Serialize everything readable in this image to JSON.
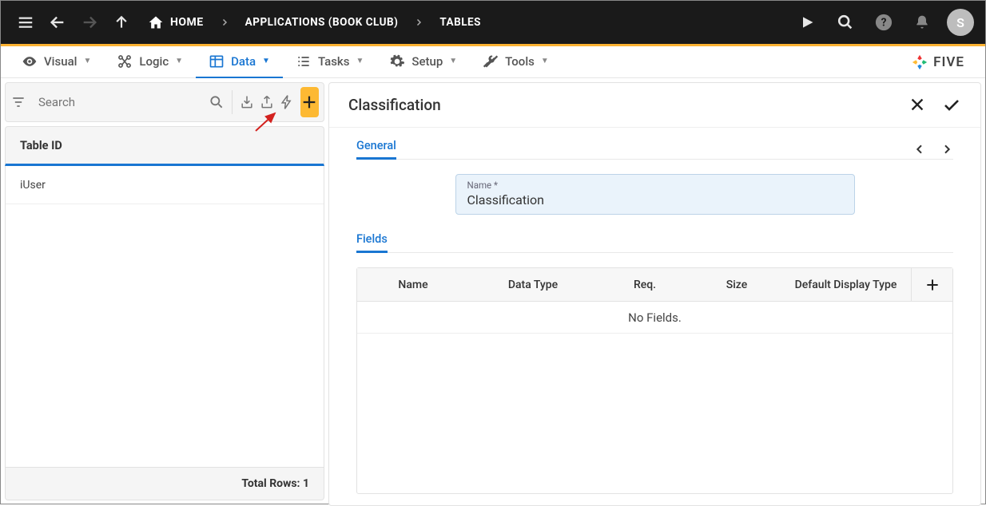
{
  "topbar": {
    "home": "HOME",
    "crumb1": "APPLICATIONS (BOOK CLUB)",
    "crumb2": "TABLES",
    "avatar": "S"
  },
  "menu": {
    "visual": "Visual",
    "logic": "Logic",
    "data": "Data",
    "tasks": "Tasks",
    "setup": "Setup",
    "tools": "Tools"
  },
  "brand": "FIVE",
  "left": {
    "search_placeholder": "Search",
    "table_header": "Table ID",
    "rows": [
      "iUser"
    ],
    "footer": "Total Rows: 1"
  },
  "detail": {
    "title": "Classification",
    "general_tab": "General",
    "name_label": "Name *",
    "name_value": "Classification",
    "fields_tab": "Fields",
    "columns": {
      "name": "Name",
      "dtype": "Data Type",
      "req": "Req.",
      "size": "Size",
      "ddt": "Default Display Type"
    },
    "empty": "No Fields."
  }
}
